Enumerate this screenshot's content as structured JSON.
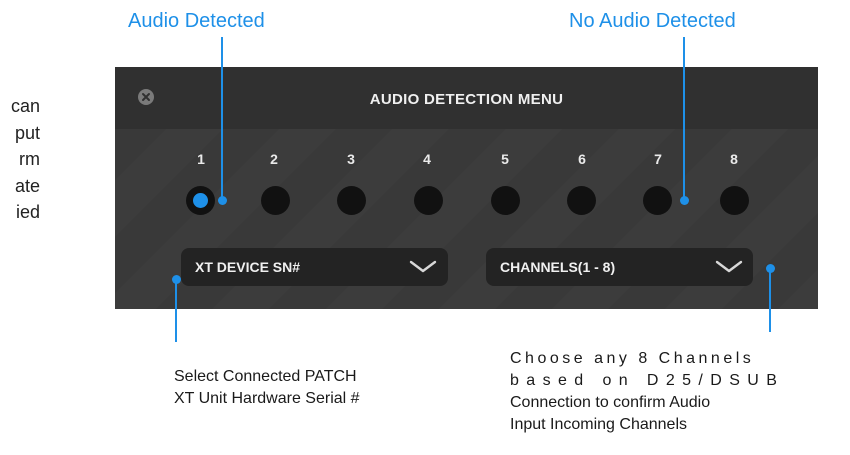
{
  "left_text_fragments": [
    "can",
    "put",
    "rm",
    "ate",
    "ied"
  ],
  "callouts": {
    "audio_detected": "Audio Detected",
    "no_audio_detected": "No Audio Detected"
  },
  "menu": {
    "title": "AUDIO DETECTION MENU",
    "close_icon": "close-icon",
    "channels": [
      {
        "number": "1",
        "audio_detected": true
      },
      {
        "number": "2",
        "audio_detected": false
      },
      {
        "number": "3",
        "audio_detected": false
      },
      {
        "number": "4",
        "audio_detected": false
      },
      {
        "number": "5",
        "audio_detected": false
      },
      {
        "number": "6",
        "audio_detected": false
      },
      {
        "number": "7",
        "audio_detected": false
      },
      {
        "number": "8",
        "audio_detected": false
      }
    ],
    "device_select": {
      "value": "XT DEVICE SN#",
      "icon": "chevron-down-icon"
    },
    "channels_select": {
      "value": "CHANNELS(1 - 8)",
      "icon": "chevron-down-icon"
    }
  },
  "captions": {
    "device_lines": [
      "Select  Connected  PATCH",
      "XT Unit Hardware Serial #"
    ],
    "channels_lines": [
      "Choose  any  8  Channels",
      "based  on  D25/DSUB",
      "Connection to confirm Audio",
      "Input Incoming Channels"
    ]
  },
  "colors": {
    "accent": "#1e90e8",
    "panel_bg": "#3a3a3a",
    "dot_inactive": "#111111"
  }
}
